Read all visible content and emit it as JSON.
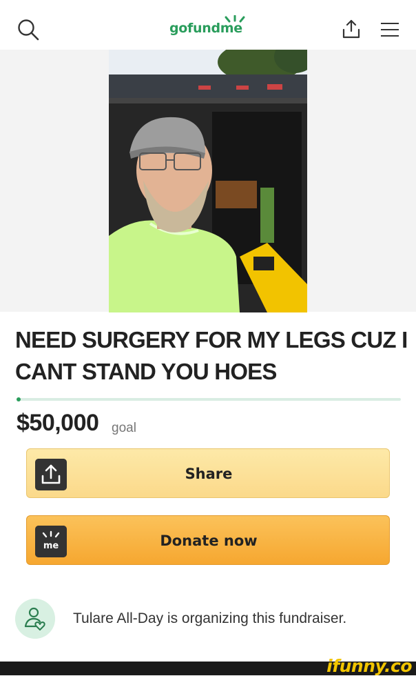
{
  "header": {
    "logo_text": "gofundme",
    "icons": [
      "search-icon",
      "share-icon",
      "menu-icon"
    ]
  },
  "campaign": {
    "title": "NEED SURGERY FOR MY LEGS CUZ I CANT STAND YOU HOES",
    "goal_amount": "$50,000",
    "goal_label": "goal",
    "progress_fraction": 0.0
  },
  "actions": {
    "share_label": "Share",
    "donate_label": "Donate now"
  },
  "organizer": {
    "text": "Tulare All-Day is organizing this fundraiser."
  },
  "watermark": "ifunny.co",
  "colors": {
    "brand_green": "#2a9d5c",
    "share_button": "#fbd98a",
    "donate_button": "#f6a730",
    "watermark_yellow": "#f2c500"
  }
}
